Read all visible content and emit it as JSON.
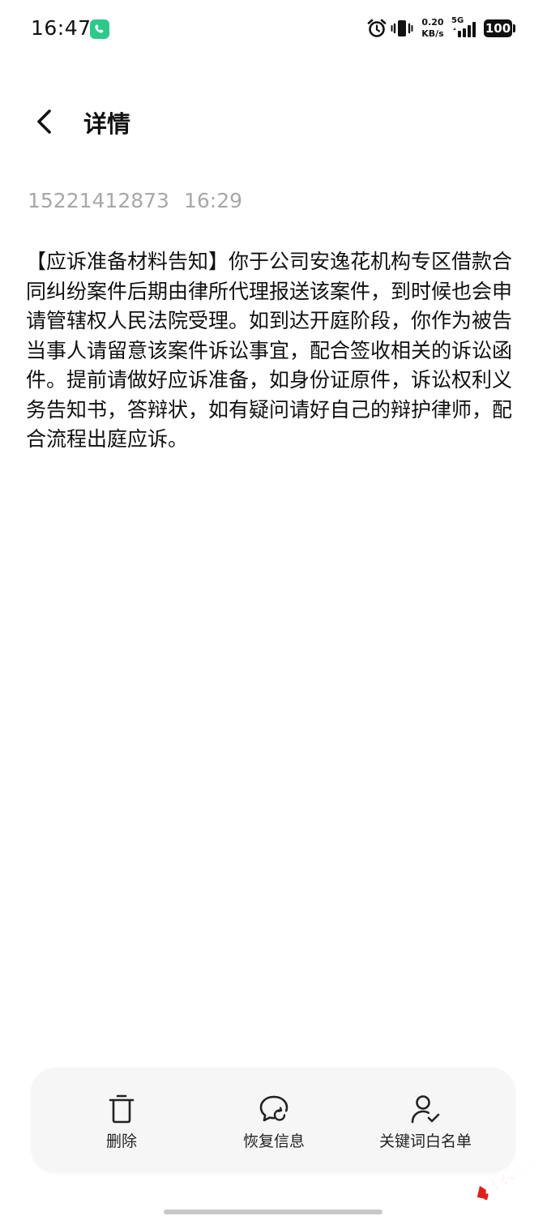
{
  "status_bar": {
    "time": "16:47",
    "net_speed_value": "0.20",
    "net_speed_unit": "KB/s",
    "network_type": "5G",
    "battery": "100",
    "icons": [
      "call-icon",
      "alarm-icon",
      "vibrate-icon",
      "signal-icon",
      "battery-icon"
    ]
  },
  "header": {
    "title": "详情"
  },
  "message": {
    "sender": "15221412873",
    "time": "16:29",
    "body": "【应诉准备材料告知】你于公司安逸花机构专区借款合同纠纷案件后期由律所代理报送该案件，到时候也会申请管辖权人民法院受理。如到达开庭阶段，你作为被告当事人请留意该案件诉讼事宜，配合签收相关的诉讼函件。提前请做好应诉准备，如身份证原件，诉讼权利义务告知书，答辩状，如有疑问请好自己的辩护律师，配合流程出庭应诉。"
  },
  "actions": {
    "delete": {
      "label": "删除",
      "icon": "trash-icon"
    },
    "restore": {
      "label": "恢复信息",
      "icon": "chat-restore-icon"
    },
    "whitelist": {
      "label": "关键词白名单",
      "icon": "user-check-icon"
    }
  },
  "watermark": {
    "text": "卡农社区"
  },
  "colors": {
    "call_badge": "#2dc98b",
    "meta_text": "#a8a8a8",
    "action_bar_bg": "#f6f6f6",
    "watermark": "#e0201a"
  }
}
